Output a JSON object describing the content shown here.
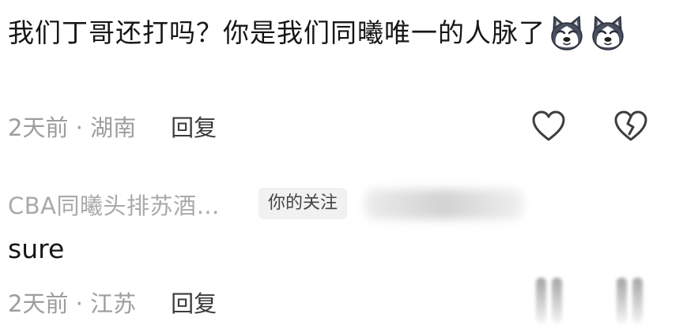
{
  "comment": {
    "text": "我们丁哥还打吗？你是我们同曦唯一的人脉了",
    "emoji": "husky-dog-emoji",
    "time": "2天前",
    "separator": " · ",
    "location": "湖南",
    "reply_label": "回复",
    "like_icon": "heart-outline-icon",
    "dislike_icon": "broken-heart-icon"
  },
  "reply": {
    "author": "CBA同曦头排苏酒…",
    "badge": "你的关注",
    "text": "sure",
    "time": "2天前",
    "separator": " · ",
    "location": "江苏",
    "reply_label": "回复"
  },
  "colors": {
    "text": "#161616",
    "meta": "#9d9d9d",
    "reply_button": "#3a3a3a",
    "badge_bg": "#f1f1f1",
    "icon_stroke": "#3d3d3d"
  }
}
